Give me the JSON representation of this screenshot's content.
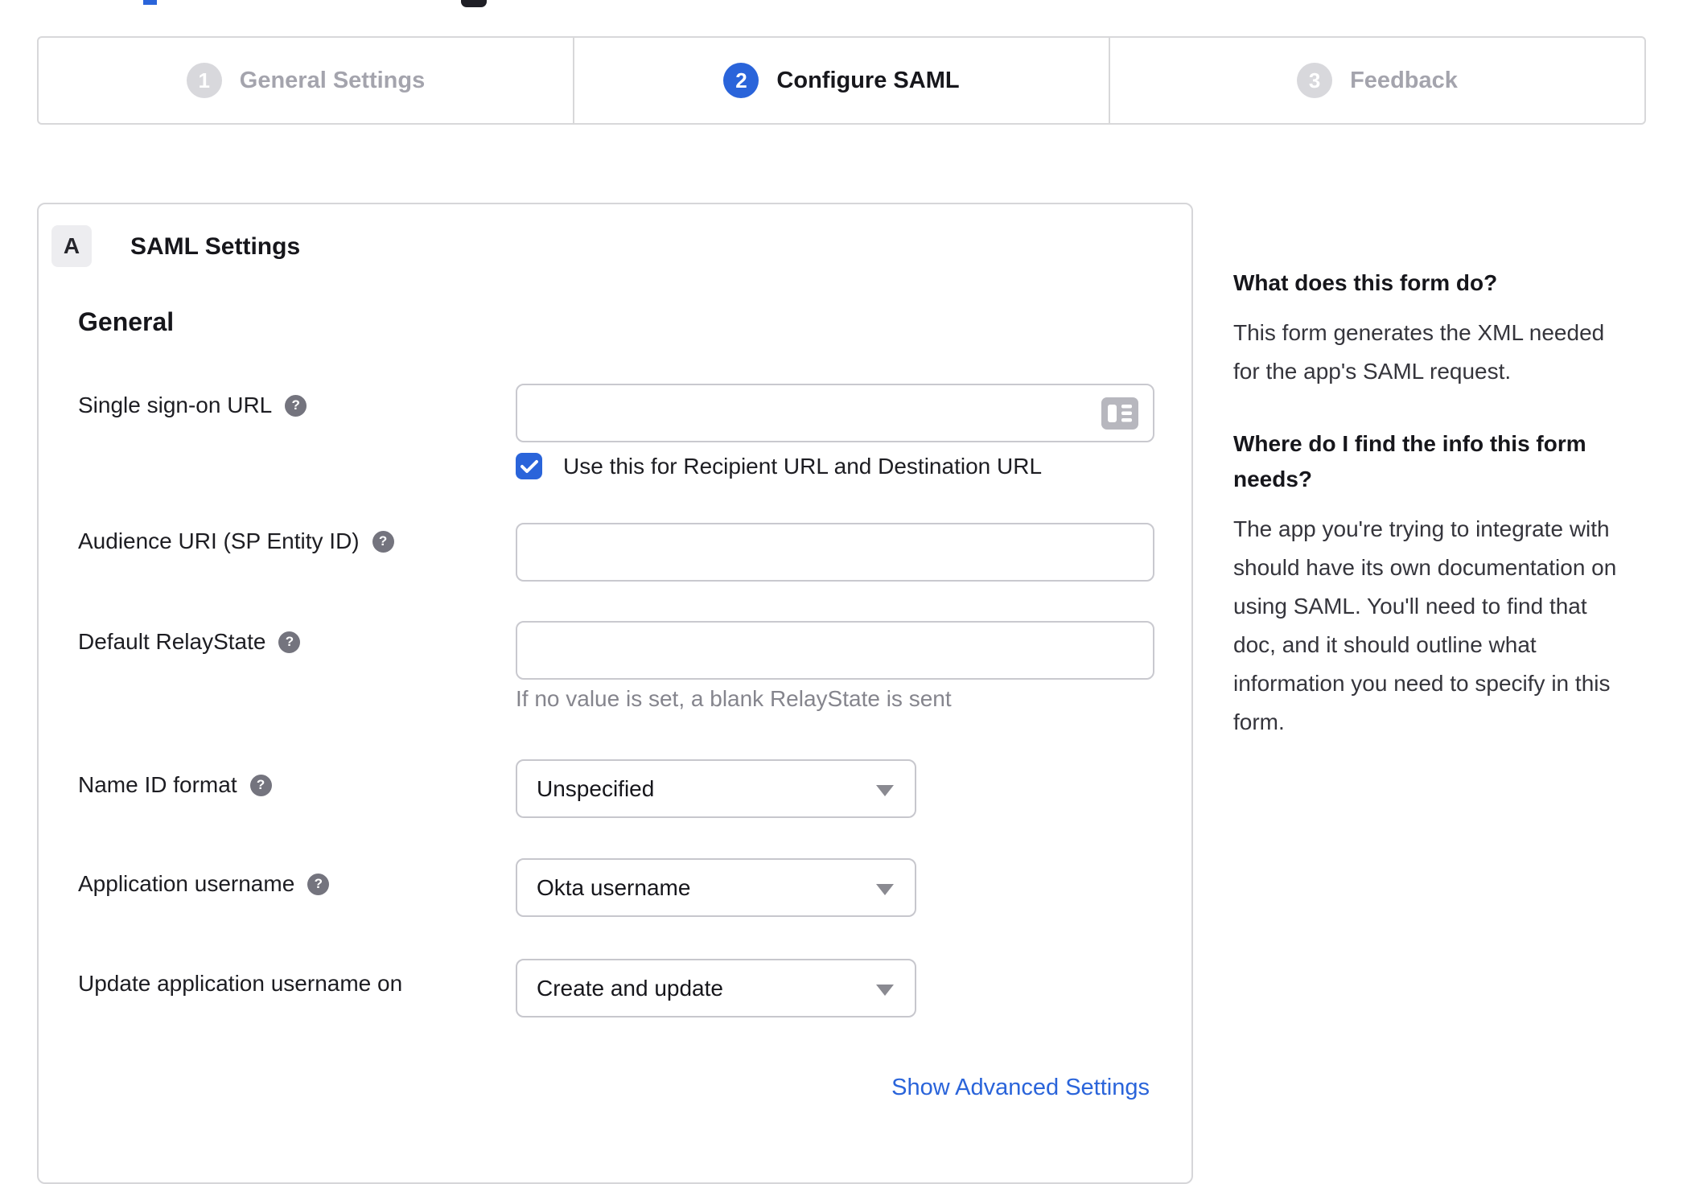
{
  "colors": {
    "accent": "#2a64da",
    "inactive_step": "#d8d8dc",
    "border": "#d6d6d9"
  },
  "icons": {
    "help_icon": "?"
  },
  "stepper": {
    "steps": [
      {
        "number": "1",
        "label": "General Settings",
        "active": false
      },
      {
        "number": "2",
        "label": "Configure SAML",
        "active": true
      },
      {
        "number": "3",
        "label": "Feedback",
        "active": false
      }
    ]
  },
  "panel": {
    "badge": "A",
    "title": "SAML Settings",
    "section_heading": "General",
    "fields": {
      "sso_url": {
        "label": "Single sign-on URL",
        "value": "",
        "checkbox_checked": true,
        "checkbox_label": "Use this for Recipient URL and Destination URL"
      },
      "audience_uri": {
        "label": "Audience URI (SP Entity ID)",
        "value": ""
      },
      "relay_state": {
        "label": "Default RelayState",
        "value": "",
        "hint": "If no value is set, a blank RelayState is sent"
      },
      "name_id_format": {
        "label": "Name ID format",
        "value": "Unspecified"
      },
      "app_username": {
        "label": "Application username",
        "value": "Okta username"
      },
      "update_app_username": {
        "label": "Update application username on",
        "value": "Create and update"
      }
    },
    "advanced_link": "Show Advanced Settings"
  },
  "sidebar": {
    "what": {
      "heading": "What does this form do?",
      "body": "This form generates the XML needed\nfor the app's SAML request."
    },
    "where": {
      "heading": "Where do I find the info this form\nneeds?",
      "body": "The app you're trying to integrate with\nshould have its own documentation on\nusing SAML. You'll need to find that\ndoc, and it should outline what\ninformation you need to specify in this\nform."
    }
  }
}
